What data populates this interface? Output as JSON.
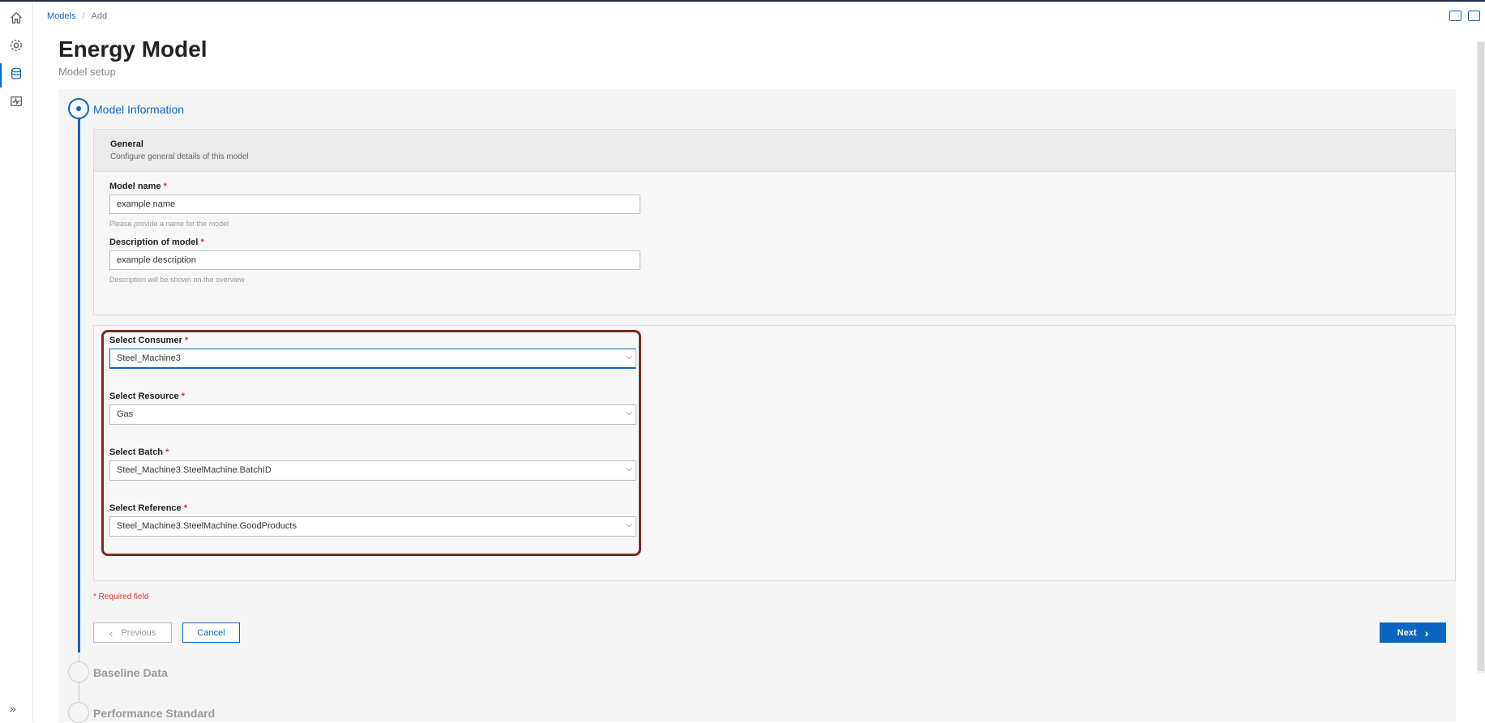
{
  "breadcrumb": {
    "root": "Models",
    "separator": "/",
    "current": "Add"
  },
  "page": {
    "title": "Energy Model",
    "subtitle": "Model setup"
  },
  "steps": [
    {
      "label": "Model Information",
      "state": "active"
    },
    {
      "label": "Baseline Data",
      "state": "inactive"
    },
    {
      "label": "Performance Standard",
      "state": "inactive"
    }
  ],
  "general": {
    "title": "General",
    "description": "Configure general details of this model",
    "model_name": {
      "label": "Model name",
      "value": "example name",
      "hint": "Please provide a name for the model"
    },
    "description_field": {
      "label": "Description of model",
      "value": "example description",
      "hint": "Description will be shown on the overview"
    }
  },
  "selects": {
    "consumer": {
      "label": "Select Consumer",
      "value": "Steel_Machine3"
    },
    "resource": {
      "label": "Select Resource",
      "value": "Gas"
    },
    "batch": {
      "label": "Select Batch",
      "value": "Steel_Machine3.SteelMachine.BatchID"
    },
    "reference": {
      "label": "Select Reference",
      "value": "Steel_Machine3.SteelMachine.GoodProducts"
    }
  },
  "required_mark": "*",
  "required_note": "* Required field",
  "buttons": {
    "previous": "Previous",
    "cancel": "Cancel",
    "next": "Next"
  },
  "icons": {
    "sidebar": [
      "home-icon",
      "settings-icon",
      "database-icon",
      "monitor-icon"
    ],
    "chevron_left": "‹",
    "chevron_right": "›",
    "chevron_down": "⌵",
    "expand": "»"
  },
  "colors": {
    "accent": "#0a66c2",
    "required": "#e0312b",
    "highlight_border": "#7a2a24"
  }
}
